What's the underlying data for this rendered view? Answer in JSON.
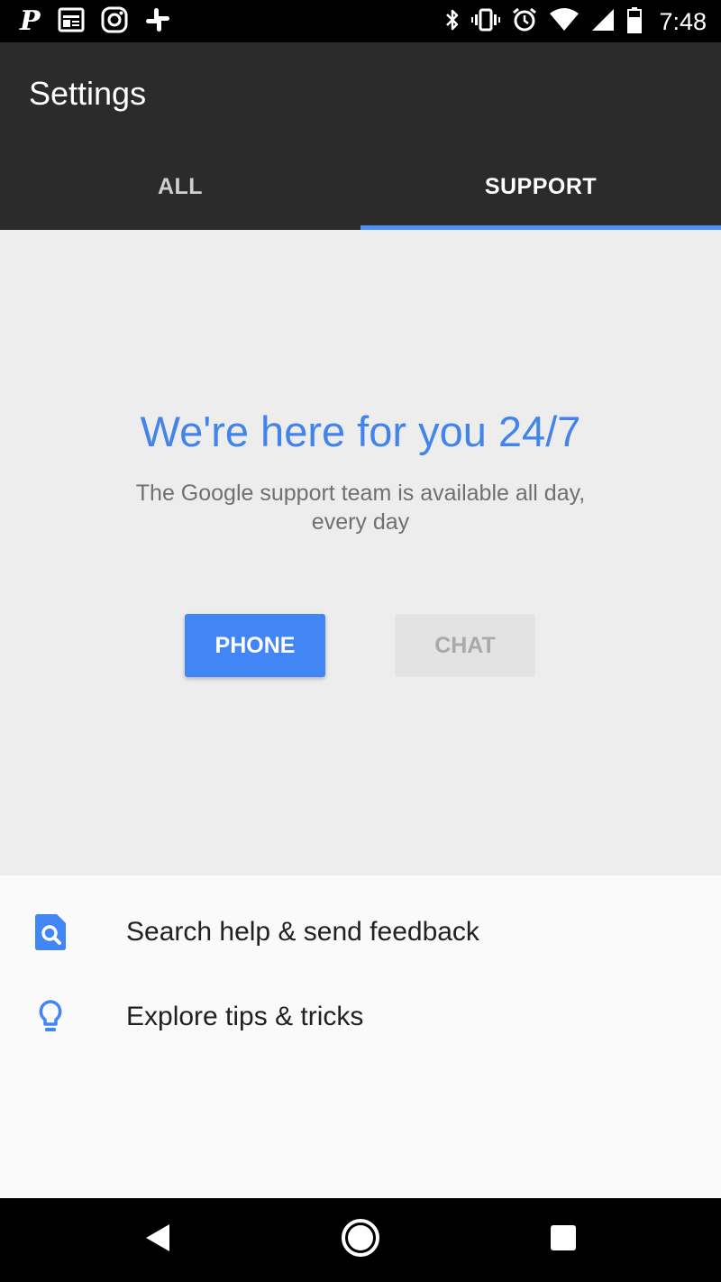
{
  "status_bar": {
    "time": "7:48",
    "left_icons": [
      "pinterest-icon",
      "news-icon",
      "instagram-icon",
      "slack-icon"
    ],
    "right_icons": [
      "bluetooth-icon",
      "vibrate-icon",
      "alarm-icon",
      "wifi-icon",
      "signal-icon",
      "battery-icon"
    ]
  },
  "app_bar": {
    "title": "Settings",
    "tabs": [
      {
        "label": "ALL",
        "active": false
      },
      {
        "label": "SUPPORT",
        "active": true
      }
    ],
    "accent_color": "#4f8ef7"
  },
  "hero": {
    "title": "We're here for you 24/7",
    "subtitle": "The Google support team is available all day, every day",
    "phone_label": "PHONE",
    "chat_label": "CHAT",
    "title_color": "#4384ea",
    "phone_color": "#4285f4"
  },
  "list": {
    "items": [
      {
        "label": "Search help & send feedback",
        "icon": "search-help-icon"
      },
      {
        "label": "Explore tips & tricks",
        "icon": "lightbulb-icon"
      }
    ]
  },
  "nav_bar": {
    "buttons": [
      "back-icon",
      "home-icon",
      "recents-icon"
    ]
  }
}
